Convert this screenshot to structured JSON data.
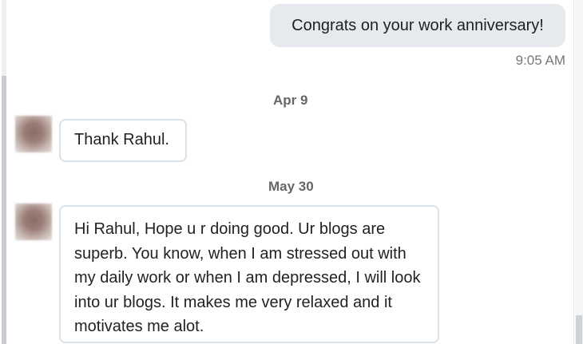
{
  "messages": {
    "outgoing": {
      "text": "Congrats on your work anniversary!",
      "time": "9:05 AM"
    },
    "groups": [
      {
        "date": "Apr 9",
        "text": "Thank Rahul."
      },
      {
        "date": "May 30",
        "text": "Hi Rahul, Hope u r doing good. Ur blogs are superb. You know, when I am stressed out with my daily work or when I am depressed, I will look into ur blogs. It makes me very relaxed and it motivates me alot."
      }
    ]
  }
}
